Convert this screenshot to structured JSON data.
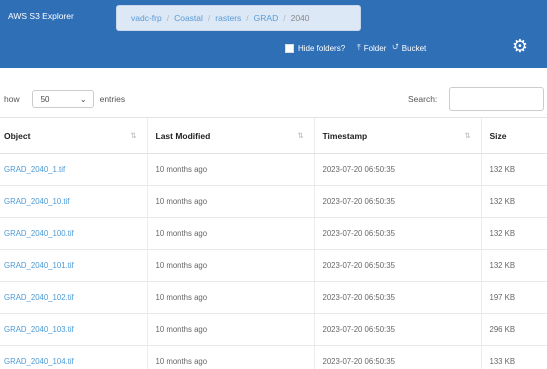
{
  "app": {
    "title": "AWS S3 Explorer"
  },
  "breadcrumb": [
    "vadc-frp",
    "Coastal",
    "rasters",
    "GRAD",
    "2040"
  ],
  "controls": {
    "hide_folders_label": "Hide folders?",
    "folder_button": "Folder",
    "bucket_button": "Bucket",
    "icons": {
      "folder": "upload-icon",
      "bucket": "bucket-icon",
      "settings": "gear-icon"
    }
  },
  "table_controls": {
    "show_prefix": "how",
    "length_value": "50",
    "entries_suffix": "entries",
    "search_label": "Search:",
    "search_value": ""
  },
  "table": {
    "columns": [
      "Object",
      "Last Modified",
      "Timestamp",
      "Size"
    ],
    "rows": [
      {
        "object": "GRAD_2040_1.tif",
        "modified": "10 months ago",
        "timestamp": "2023-07-20 06:50:35",
        "size": "132 KB"
      },
      {
        "object": "GRAD_2040_10.tif",
        "modified": "10 months ago",
        "timestamp": "2023-07-20 06:50:35",
        "size": "132 KB"
      },
      {
        "object": "GRAD_2040_100.tif",
        "modified": "10 months ago",
        "timestamp": "2023-07-20 06:50:35",
        "size": "132 KB"
      },
      {
        "object": "GRAD_2040_101.tif",
        "modified": "10 months ago",
        "timestamp": "2023-07-20 06:50:35",
        "size": "132 KB"
      },
      {
        "object": "GRAD_2040_102.tif",
        "modified": "10 months ago",
        "timestamp": "2023-07-20 06:50:35",
        "size": "197 KB"
      },
      {
        "object": "GRAD_2040_103.tif",
        "modified": "10 months ago",
        "timestamp": "2023-07-20 06:50:35",
        "size": "296 KB"
      },
      {
        "object": "GRAD_2040_104.tif",
        "modified": "10 months ago",
        "timestamp": "2023-07-20 06:50:35",
        "size": "133 KB"
      }
    ]
  },
  "colors": {
    "topbar": "#2f6fb6",
    "link": "#4a9ad8",
    "breadcrumb_bg": "#dce8f5"
  }
}
